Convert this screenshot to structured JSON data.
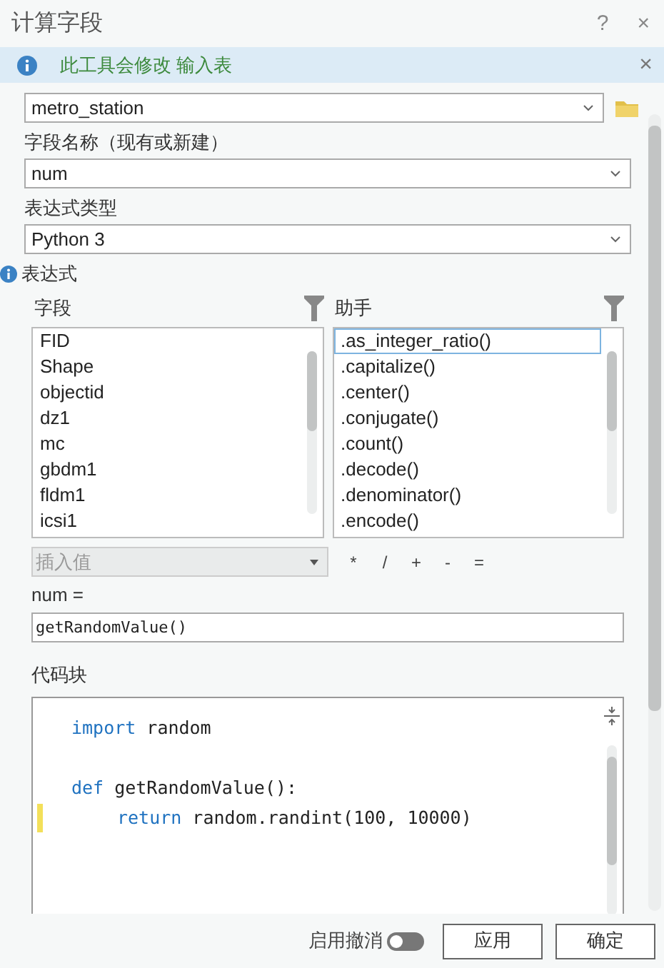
{
  "window": {
    "title": "计算字段",
    "help": "?",
    "close": "×"
  },
  "banner": {
    "text": "此工具会修改 输入表",
    "close": "×"
  },
  "input_table": {
    "value": "metro_station"
  },
  "field_name": {
    "label": "字段名称（现有或新建）",
    "value": "num"
  },
  "expression_type": {
    "label": "表达式类型",
    "value": "Python 3"
  },
  "expression": {
    "label": "表达式",
    "fields": {
      "label": "字段",
      "items": [
        {
          "text": "FID",
          "selected": false
        },
        {
          "text": "Shape",
          "selected": false
        },
        {
          "text": "objectid",
          "selected": false
        },
        {
          "text": "dz1",
          "selected": false
        },
        {
          "text": "mc",
          "selected": false
        },
        {
          "text": "gbdm1",
          "selected": false
        },
        {
          "text": "fldm1",
          "selected": false
        },
        {
          "text": "icsi1",
          "selected": false
        }
      ]
    },
    "helpers": {
      "label": "助手",
      "items": [
        {
          "text": ".as_integer_ratio()",
          "selected": true
        },
        {
          "text": ".capitalize()",
          "selected": false
        },
        {
          "text": ".center()",
          "selected": false
        },
        {
          "text": ".conjugate()",
          "selected": false
        },
        {
          "text": ".count()",
          "selected": false
        },
        {
          "text": ".decode()",
          "selected": false
        },
        {
          "text": ".denominator()",
          "selected": false
        },
        {
          "text": ".encode()",
          "selected": false
        }
      ]
    },
    "insert_value": {
      "placeholder": "插入值",
      "disabled": true
    },
    "operators": [
      "*",
      "/",
      "+",
      "-",
      "="
    ],
    "target_label": "num =",
    "value": "getRandomValue()"
  },
  "code_block": {
    "label": "代码块",
    "lines": [
      {
        "changed": false,
        "tokens": [
          {
            "kind": "keyword",
            "text": "import"
          },
          {
            "kind": "plain",
            "text": " random"
          }
        ]
      },
      {
        "changed": false
      },
      {
        "changed": false,
        "tokens": [
          {
            "kind": "keyword",
            "text": "def"
          },
          {
            "kind": "plain",
            "text": " getRandomValue():"
          }
        ],
        "children": [
          {
            "changed": true,
            "tokens": [
              {
                "kind": "keyword",
                "text": "return"
              },
              {
                "kind": "plain",
                "text": " random.randint(100, 10000)"
              }
            ]
          }
        ]
      }
    ]
  },
  "footer": {
    "undo": {
      "label": "启用撤消",
      "on": false
    },
    "buttons": [
      "应用",
      "确定"
    ]
  }
}
